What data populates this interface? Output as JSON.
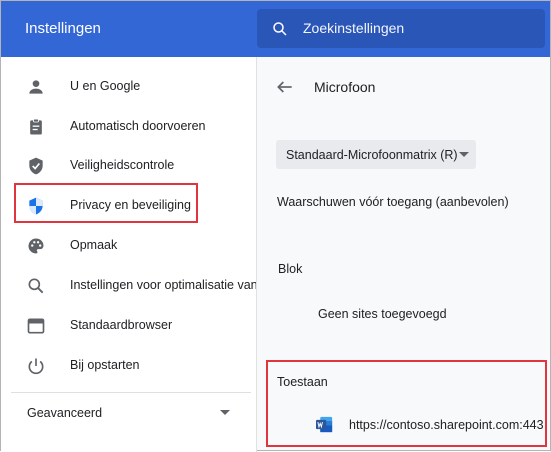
{
  "header": {
    "title": "Instellingen",
    "search_placeholder": "Zoekinstellingen"
  },
  "sidebar": {
    "items": [
      {
        "label": "U en Google",
        "icon": "person-icon"
      },
      {
        "label": "Automatisch doorvoeren",
        "icon": "clipboard-icon"
      },
      {
        "label": "Veiligheidscontrole",
        "icon": "shield-check-icon"
      },
      {
        "label": "Privacy en beveiliging",
        "icon": "shield-privacy-icon",
        "selected": true
      },
      {
        "label": "Opmaak",
        "icon": "palette-icon"
      },
      {
        "label": "Instellingen voor optimalisatie van zoekprogramma's",
        "icon": "search-icon"
      },
      {
        "label": "Standaardbrowser",
        "icon": "browser-icon"
      },
      {
        "label": "Bij opstarten",
        "icon": "power-icon"
      }
    ],
    "advanced_label": "Geavanceerd"
  },
  "main": {
    "title": "Microfoon",
    "device_select": "Standaard-Microfoonmatrix (R)",
    "ask_option": "Waarschuwen vóór toegang (aanbevolen)",
    "block": {
      "title": "Blok",
      "empty_text": "Geen sites toegevoegd"
    },
    "allow": {
      "title": "Toestaan",
      "sites": [
        {
          "url": "https://contoso.sharepoint.com:443",
          "icon": "word-icon"
        }
      ]
    }
  },
  "colors": {
    "header_bg": "#3367d6",
    "search_bg": "#2a56b8",
    "accent_blue": "#1a73e8",
    "highlight_red": "#e0353f",
    "word_blue": "#2b579a"
  }
}
